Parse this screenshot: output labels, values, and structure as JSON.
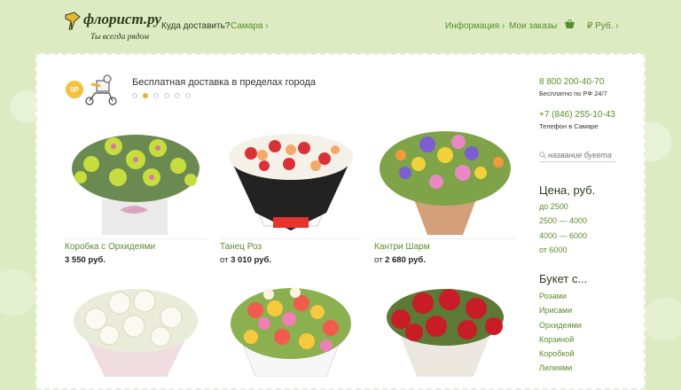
{
  "header": {
    "logo": "флорист.ру",
    "slogan": "Ты всегда рядом",
    "where": "Куда доставить?",
    "city": "Самара",
    "info": "Информация",
    "orders": "Мои заказы",
    "currency": "₽ Руб."
  },
  "promo": {
    "badge": "0Р",
    "text": "Бесплатная доставка в пределах города",
    "slides": 6,
    "active_slide": 2
  },
  "products": [
    {
      "name": "Коробка с Орхидеями",
      "price": "3 550 руб."
    },
    {
      "name": "Танец Роз",
      "price_prefix": "от",
      "price": "3 010 руб."
    },
    {
      "name": "Кантри Шарм",
      "price_prefix": "от",
      "price": "2 680 руб."
    },
    {
      "name": "",
      "price": ""
    },
    {
      "name": "",
      "price": ""
    },
    {
      "name": "",
      "price": ""
    }
  ],
  "sidebar": {
    "phone1": "8 800 200-40-70",
    "phone1_note": "Бесплатно по РФ 24/7",
    "phone2": "+7 (846) 255-10-43",
    "phone2_note": "Телефон в Самаре",
    "search_placeholder": "название букета",
    "price_heading": "Цена, руб.",
    "price_ranges": [
      "до 2500",
      "2500 — 4000",
      "4000 — 6000",
      "от 6000"
    ],
    "bouquet_heading": "Букет с...",
    "bouquet_types": [
      "Розами",
      "Ирисами",
      "Орхидеями",
      "Корзиной",
      "Коробкой",
      "Лилиями"
    ]
  },
  "colors": {
    "accent_green": "#5a8c2a",
    "background": "#dcebc2",
    "dot_active": "#e8b23c"
  }
}
